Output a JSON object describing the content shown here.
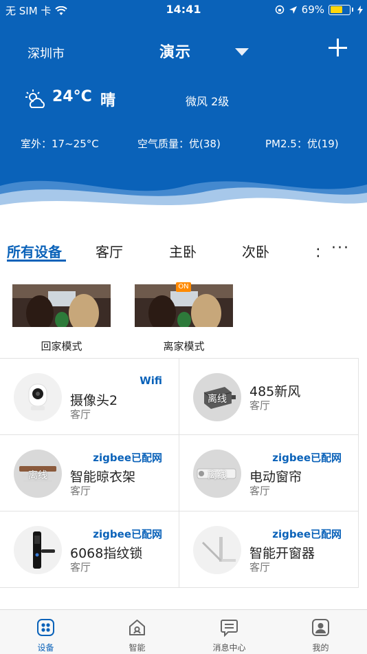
{
  "status_bar": {
    "carrier": "无 SIM 卡",
    "time": "14:41",
    "battery_percent": "69%",
    "battery_level": 0.69
  },
  "header": {
    "city": "深圳市",
    "home_name": "演示",
    "dropdown_icon": "triangle-down-icon",
    "add_icon": "plus-icon"
  },
  "weather": {
    "icon": "partly-cloudy-icon",
    "temperature": "24°C",
    "condition": "晴",
    "wind": "微风 2级",
    "outdoor": "室外：17~25°C",
    "air_quality": "空气质量：优(38)",
    "pm25": "PM2.5：优(19)"
  },
  "tabs": {
    "items": [
      "所有设备",
      "客厅",
      "主卧",
      "次卧"
    ],
    "active_index": 0,
    "more_label": "···"
  },
  "scenes": [
    {
      "label": "回家模式",
      "badge": ""
    },
    {
      "label": "离家模式",
      "badge": "ON"
    }
  ],
  "devices": [
    {
      "name": "摄像头2",
      "room": "客厅",
      "tag": "Wifi",
      "offline_label": ""
    },
    {
      "name": "485新风",
      "room": "客厅",
      "tag": "",
      "offline_label": "离线"
    },
    {
      "name": "智能晾衣架",
      "room": "客厅",
      "tag": "zigbee已配网",
      "offline_label": "离线"
    },
    {
      "name": "电动窗帘",
      "room": "客厅",
      "tag": "zigbee已配网",
      "offline_label": "离线"
    },
    {
      "name": "6068指纹锁",
      "room": "客厅",
      "tag": "zigbee已配网",
      "offline_label": ""
    },
    {
      "name": "智能开窗器",
      "room": "客厅",
      "tag": "zigbee已配网",
      "offline_label": ""
    }
  ],
  "tabbar": {
    "items": [
      {
        "label": "设备",
        "icon": "devices-grid-icon"
      },
      {
        "label": "智能",
        "icon": "smart-home-icon"
      },
      {
        "label": "消息中心",
        "icon": "message-icon"
      },
      {
        "label": "我的",
        "icon": "profile-icon"
      }
    ],
    "active_index": 0
  },
  "colors": {
    "primary": "#0a62b9",
    "badge_on": "#ff8a00",
    "battery": "#ffd60a"
  }
}
